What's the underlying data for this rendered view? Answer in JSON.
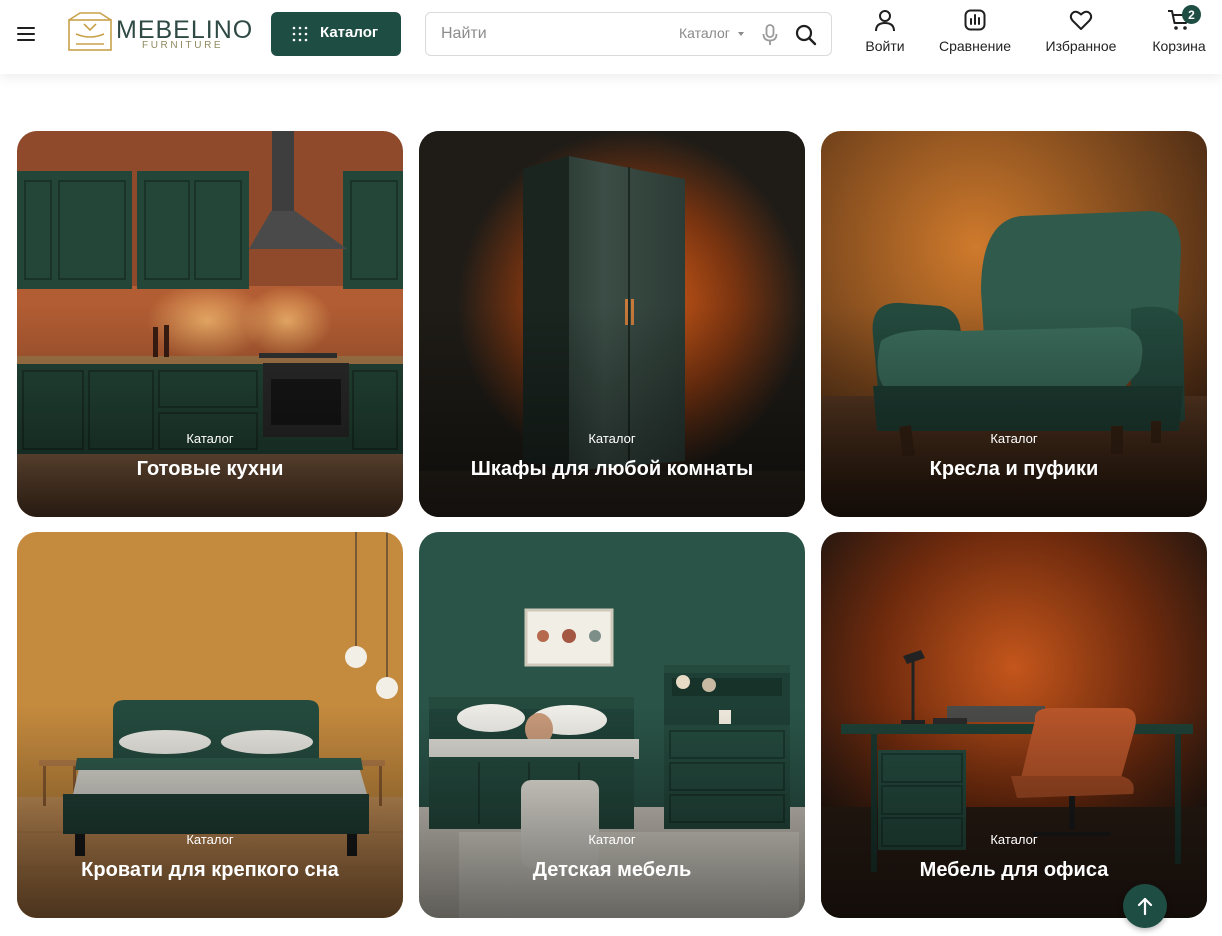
{
  "header": {
    "logo": {
      "word": "MEBELINO",
      "sub": "FURNITURE"
    },
    "catalog_button": "Каталог",
    "search": {
      "placeholder": "Найти",
      "scope": "Каталог"
    },
    "actions": {
      "login": "Войти",
      "compare": "Сравнение",
      "favorites": "Избранное",
      "cart": "Корзина",
      "cart_count": "2"
    }
  },
  "cards": [
    {
      "kicker": "Каталог",
      "title": "Готовые кухни"
    },
    {
      "kicker": "Каталог",
      "title": "Шкафы для любой комнаты"
    },
    {
      "kicker": "Каталог",
      "title": "Кресла и пуфики"
    },
    {
      "kicker": "Каталог",
      "title": "Кровати для крепкого сна"
    },
    {
      "kicker": "Каталог",
      "title": "Детская мебель"
    },
    {
      "kicker": "Каталог",
      "title": "Мебель для офиса"
    }
  ],
  "colors": {
    "brand": "#1e4d43",
    "accent": "#c8a14a"
  }
}
